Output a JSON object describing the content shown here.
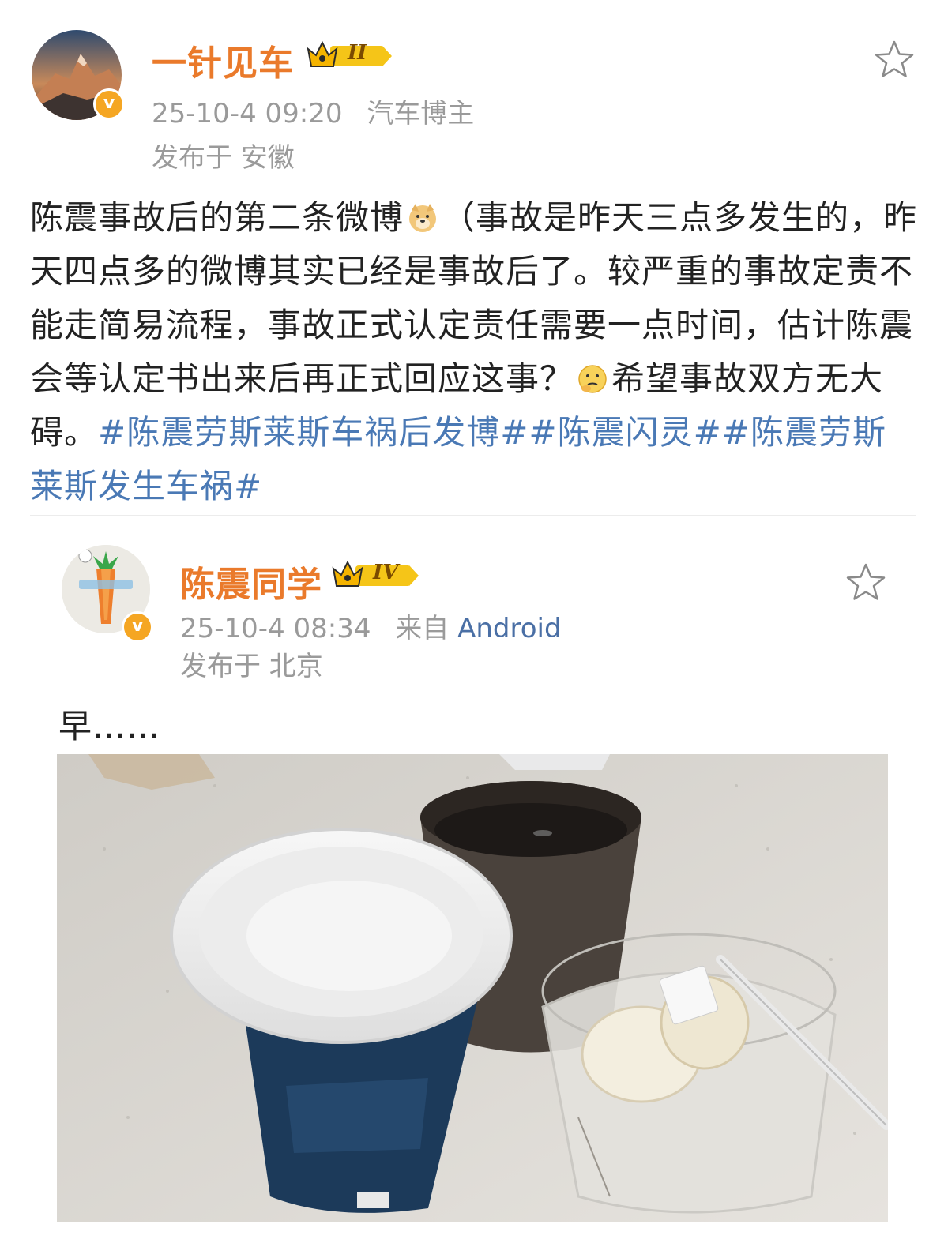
{
  "post": {
    "username": "一针见车",
    "rank": "II",
    "time": "25-10-4 09:20",
    "role": "汽车博主",
    "location": "发布于 安徽",
    "text_before_emoji": "陈震事故后的第二条微博",
    "text_middle": "（事故是昨天三点多发生的，昨天四点多的微博其实已经是事故后了。较严重的事故定责不能走简易流程，事故正式认定责任需要一点时间，估计陈震会等认定书出来后再正式回应这事？",
    "text_after_emoji": "希望事故双方无大碍。",
    "hashtags": [
      "#陈震劳斯莱斯车祸后发博#",
      "#陈震闪灵#",
      "#陈震劳斯莱斯发生车祸#"
    ],
    "verified_badge": "v",
    "avatar_icon": "mountain-avatar",
    "favorite_icon": "star-outline"
  },
  "repost": {
    "username": "陈震同学",
    "rank": "IV",
    "time": "25-10-4 08:34",
    "source_prefix": "来自",
    "source": "Android",
    "location": "发布于 北京",
    "text": "早……",
    "verified_badge": "v",
    "avatar_icon": "carrot-avatar",
    "favorite_icon": "star-outline",
    "photo": "breakfast-photo"
  },
  "colors": {
    "username": "#ea7a2b",
    "hashtag": "#4a79b5",
    "meta": "#9a9a9a",
    "badge": "#f5a623"
  }
}
